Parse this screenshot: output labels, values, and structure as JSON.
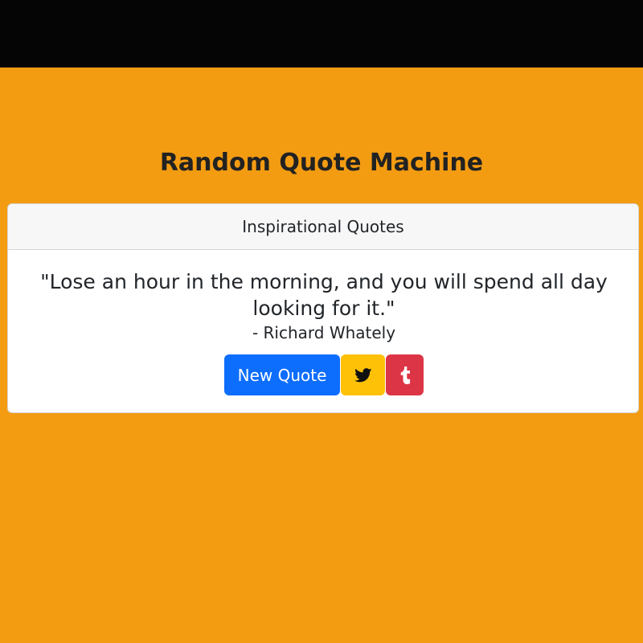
{
  "header": {
    "title": "Random Quote Machine"
  },
  "card": {
    "header_label": "Inspirational Quotes",
    "quote": "\"Lose an hour in the morning, and you will spend all day looking for it.\"",
    "author": "- Richard Whately"
  },
  "buttons": {
    "new_quote_label": "New Quote",
    "twitter_icon": "twitter-icon",
    "tumblr_icon": "tumblr-icon"
  },
  "colors": {
    "background": "#f39c12",
    "top_bar": "#050505",
    "new_quote": "#0d6efd",
    "twitter": "#ffc107",
    "tumblr": "#dc3545"
  }
}
